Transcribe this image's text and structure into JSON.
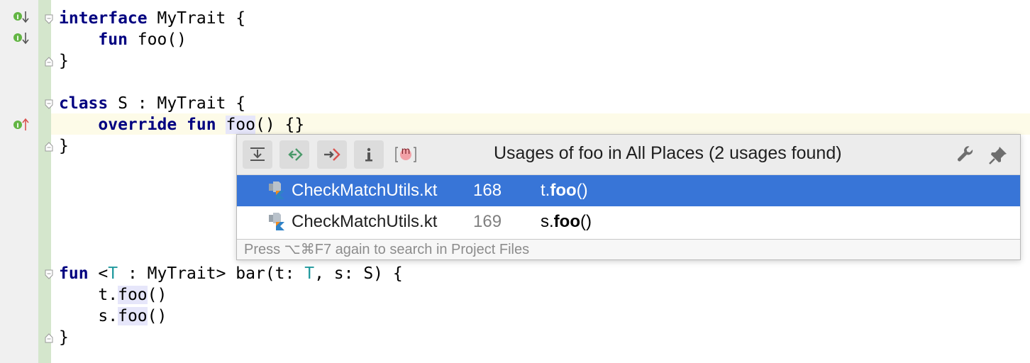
{
  "editor": {
    "lines": {
      "l1": {
        "kw": "interface",
        "rest": " MyTrait {"
      },
      "l2": {
        "indent": "    ",
        "kw": "fun",
        "rest": " foo()"
      },
      "l3": {
        "text": "}"
      },
      "l5": {
        "kw": "class",
        "rest": " S : MyTrait {"
      },
      "l6": {
        "indent": "    ",
        "kw1": "override",
        "sp": " ",
        "kw2": "fun",
        "sp2": " ",
        "hl": "foo",
        "rest": "() {}"
      },
      "l7": {
        "text": "}"
      },
      "l13": {
        "kw": "fun",
        "a": " <",
        "tp": "T",
        "b": " : MyTrait> bar(t: ",
        "tp2": "T",
        "c": ", s: S) {"
      },
      "l14": {
        "indent": "    ",
        "pre": "t.",
        "hl": "foo",
        "rest": "()"
      },
      "l15": {
        "indent": "    ",
        "pre": "s.",
        "hl": "foo",
        "rest": "()"
      },
      "l16": {
        "text": "}"
      }
    },
    "gutter_icons": [
      "implemented-icon",
      "implemented-icon",
      "implements-icon"
    ]
  },
  "popup": {
    "title": "Usages of foo in All Places (2 usages found)",
    "toolbar": [
      "open-in-find-tool-window-icon",
      "previous-usage-icon",
      "next-usage-icon",
      "info-icon",
      "method-icon"
    ],
    "method_badge": "m",
    "rows": [
      {
        "file": "CheckMatchUtils.kt",
        "line": "168",
        "prefix": "t.",
        "bold": "foo",
        "suffix": "()",
        "selected": true
      },
      {
        "file": "CheckMatchUtils.kt",
        "line": "169",
        "prefix": "s.",
        "bold": "foo",
        "suffix": "()",
        "selected": false
      }
    ],
    "footer": "Press ⌥⌘F7 again to search in Project Files"
  },
  "colors": {
    "keyword": "#000080",
    "type_param": "#20999d",
    "selection": "#3875d7",
    "gutter_strip": "#d4e6cc",
    "caret_line": "#fdfbe8"
  }
}
